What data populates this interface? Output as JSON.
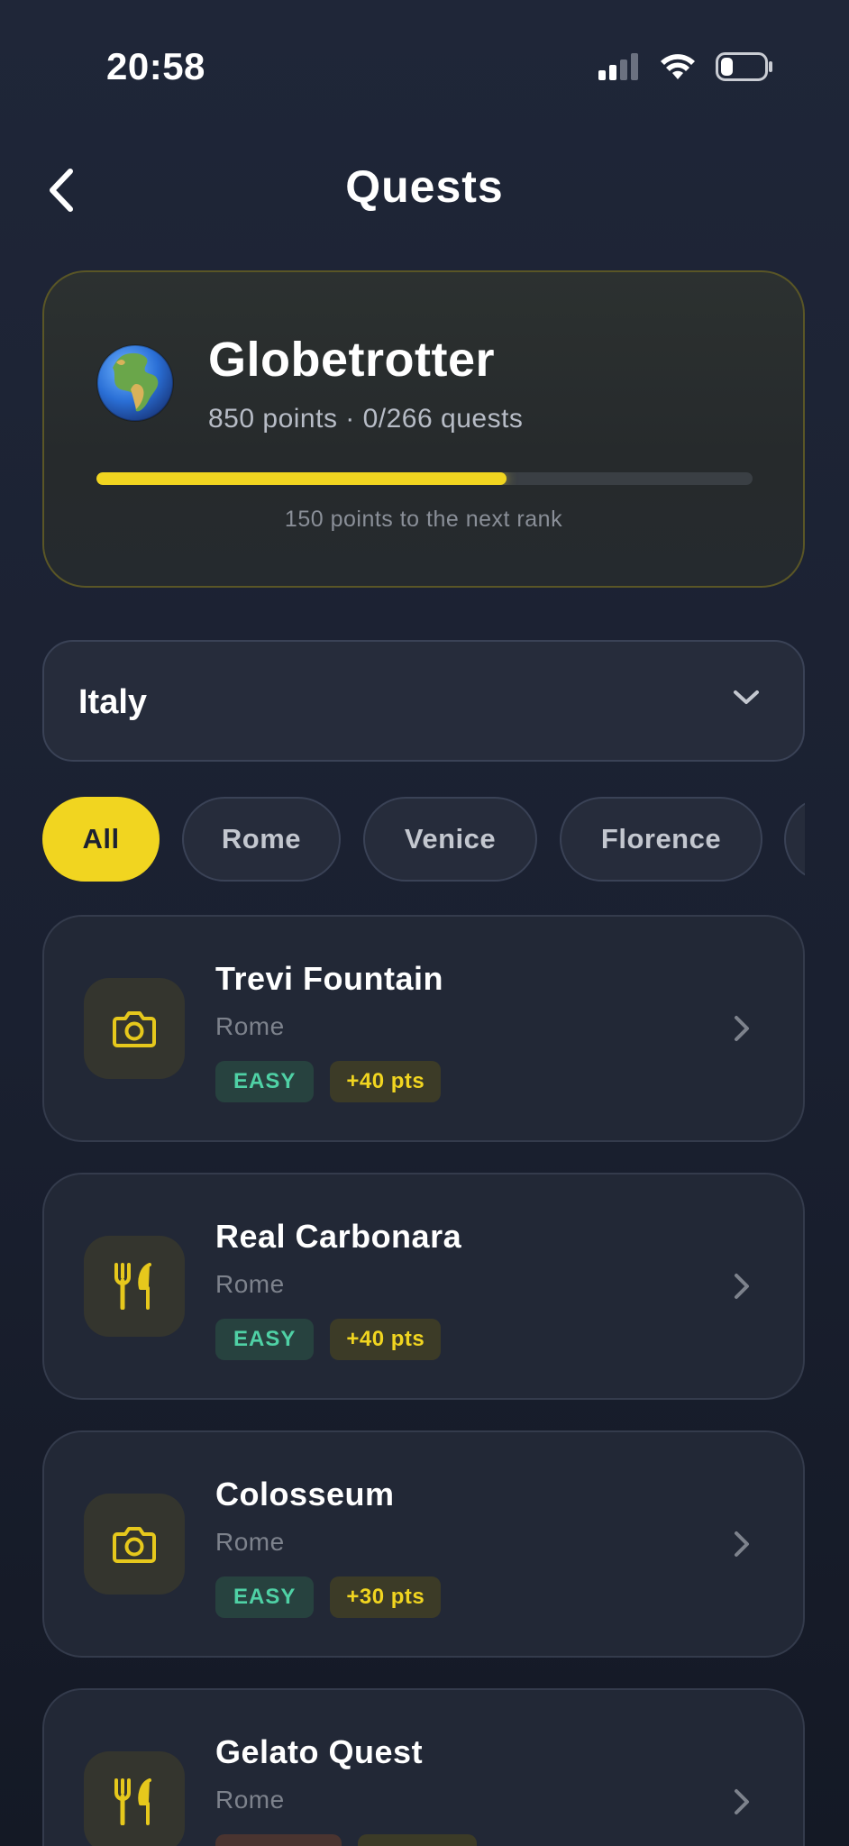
{
  "status_bar": {
    "time": "20:58"
  },
  "header": {
    "title": "Quests"
  },
  "rank_card": {
    "icon": "globe-icon",
    "name": "Globetrotter",
    "stats": "850 points · 0/266 quests",
    "progress_fraction": 0.625,
    "next_rank_text": "150 points to the next rank"
  },
  "country_select": {
    "selected": "Italy"
  },
  "city_filters": [
    "All",
    "Rome",
    "Venice",
    "Florence",
    ""
  ],
  "quests": [
    {
      "title": "Trevi Fountain",
      "city": "Rome",
      "difficulty": "EASY",
      "points": "+40 pts",
      "icon": "camera-icon"
    },
    {
      "title": "Real Carbonara",
      "city": "Rome",
      "difficulty": "EASY",
      "points": "+40 pts",
      "icon": "fork-knife-icon"
    },
    {
      "title": "Colosseum",
      "city": "Rome",
      "difficulty": "EASY",
      "points": "+30 pts",
      "icon": "camera-icon"
    },
    {
      "title": "Gelato Quest",
      "city": "Rome",
      "difficulty": "",
      "points": "",
      "icon": "fork-knife-icon"
    }
  ],
  "colors": {
    "accent": "#f1d520",
    "easy": "#4fd1a5",
    "background": "#1f2638",
    "card": "#222836"
  }
}
